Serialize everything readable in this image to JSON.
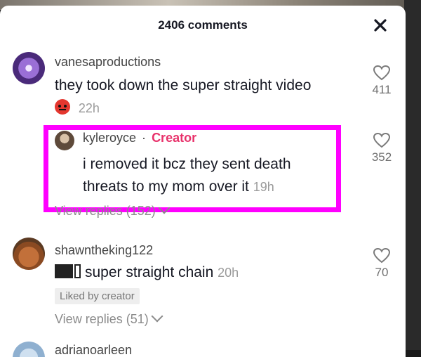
{
  "header": {
    "title": "2406 comments"
  },
  "comments": [
    {
      "username": "vanesaproductions",
      "text": "they took down the super straight video",
      "time": "22h",
      "likes": "411",
      "avatar_color": "#6b3fa0"
    },
    {
      "username": "kyleroyce",
      "separator": "·",
      "badge": "Creator",
      "text_line1": "i removed it bcz they sent death",
      "text_line2": "threats to my mom over it",
      "time": "19h",
      "likes": "352",
      "view_replies": "View replies (152)"
    },
    {
      "username": "shawntheking122",
      "text": "super straight chain",
      "time": "20h",
      "likes": "70",
      "liked_by_creator": "Liked by creator",
      "view_replies": "View replies (51)"
    },
    {
      "username": "adrianoarleen"
    }
  ],
  "colors": {
    "highlight": "#ff00ff",
    "creator_badge": "#e8326b"
  }
}
